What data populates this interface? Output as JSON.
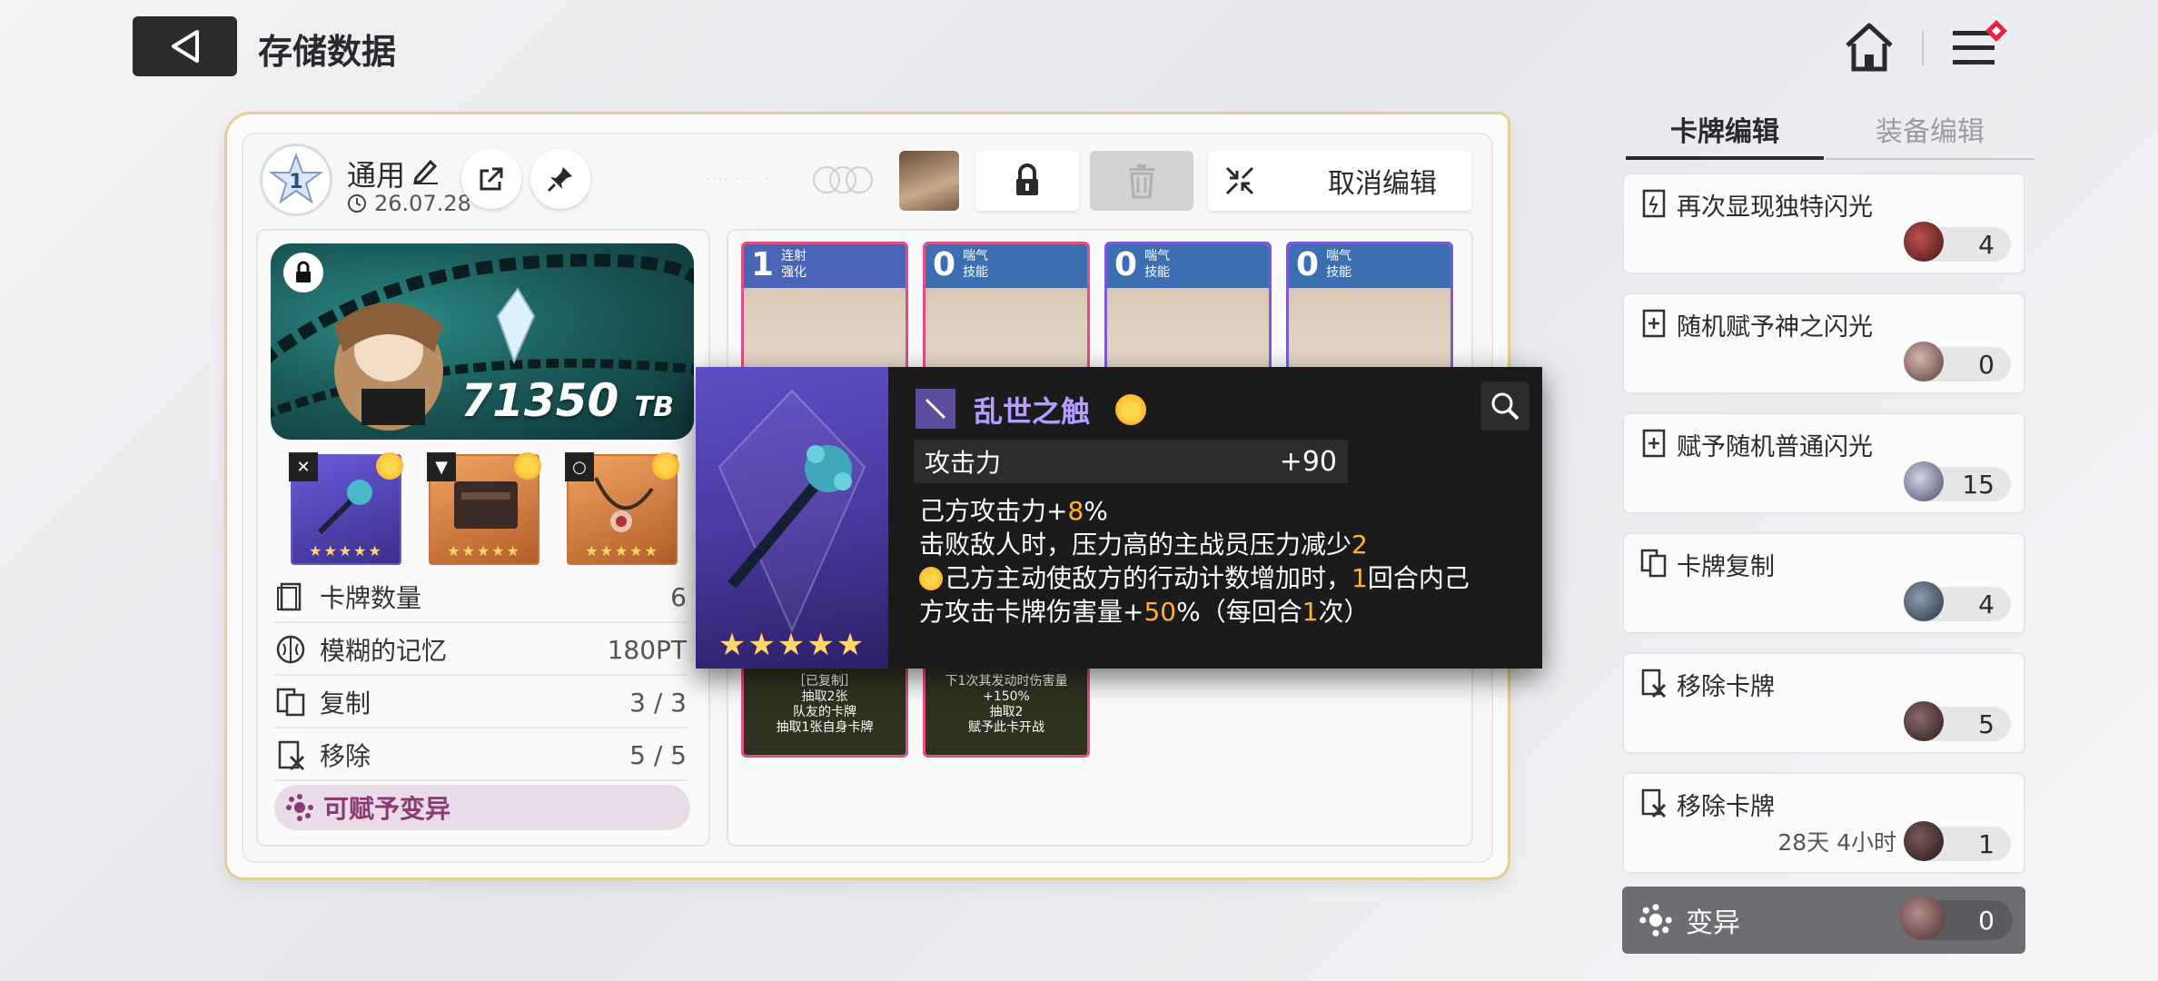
{
  "header": {
    "title": "存储数据"
  },
  "deck": {
    "level": "1",
    "name": "通用",
    "date": "26.07.28",
    "cancel_edit_label": "取消编辑"
  },
  "banner": {
    "value": "71350",
    "unit": "TB"
  },
  "equipment": [
    {
      "type": "weapon-icon",
      "stars": "★★★★★"
    },
    {
      "type": "armor-icon",
      "stars": "★★★★★"
    },
    {
      "type": "ring-icon",
      "stars": "★★★★★"
    }
  ],
  "stats": [
    {
      "label": "卡牌数量",
      "value": "6"
    },
    {
      "label": "模糊的记忆",
      "value": "180PT"
    },
    {
      "label": "复制",
      "value": "3 / 3"
    },
    {
      "label": "移除",
      "value": "5 / 5"
    }
  ],
  "mutate_pill": "可赋予变异",
  "cards": [
    {
      "cost": "1",
      "name": "连射",
      "tag": "强化",
      "text": [
        "［已复制］",
        "抽取2张",
        "队友的卡牌",
        "抽取1张自身卡牌"
      ]
    },
    {
      "cost": "0",
      "name": "喘气",
      "tag": "技能",
      "text": [
        "下1次其发动时伤害量",
        "+150%",
        "抽取2",
        "赋予此卡开战"
      ]
    },
    {
      "cost": "0",
      "name": "喘气",
      "tag": "技能"
    },
    {
      "cost": "0",
      "name": "喘气",
      "tag": "技能"
    }
  ],
  "tooltip": {
    "name": "乱世之触",
    "stat_label": "攻击力",
    "stat_value": "+90",
    "desc_line1_a": "己方攻击力+",
    "desc_line1_b": "8",
    "desc_line1_c": "%",
    "desc_line2_a": "击败敌人时，压力高的主战员压力减少",
    "desc_line2_b": "2",
    "desc_line3_a": "己方主动使敌方的行动计数增加时，",
    "desc_line3_b": "1",
    "desc_line3_c": "回合内己",
    "desc_line4_a": "方攻击卡牌伤害量+",
    "desc_line4_b": "50",
    "desc_line4_c": "%（每回合",
    "desc_line4_d": "1",
    "desc_line4_e": "次）",
    "stars": "★★★★★"
  },
  "right_panel": {
    "tabs": [
      "卡牌编辑",
      "装备编辑"
    ],
    "modifiers": [
      {
        "label": "再次显现独特闪光",
        "count": "4"
      },
      {
        "label": "随机赋予神之闪光",
        "count": "0"
      },
      {
        "label": "赋予随机普通闪光",
        "count": "15"
      },
      {
        "label": "卡牌复制",
        "count": "4"
      },
      {
        "label": "移除卡牌",
        "count": "5"
      },
      {
        "label": "移除卡牌",
        "count": "1",
        "timer": "28天 4小时"
      }
    ],
    "mutate": {
      "label": "变异",
      "count": "0"
    }
  },
  "colors": {
    "accent_gold": "#e3cf95",
    "highlight": "#ffb32e",
    "tooltip_name": "#b79cff"
  }
}
